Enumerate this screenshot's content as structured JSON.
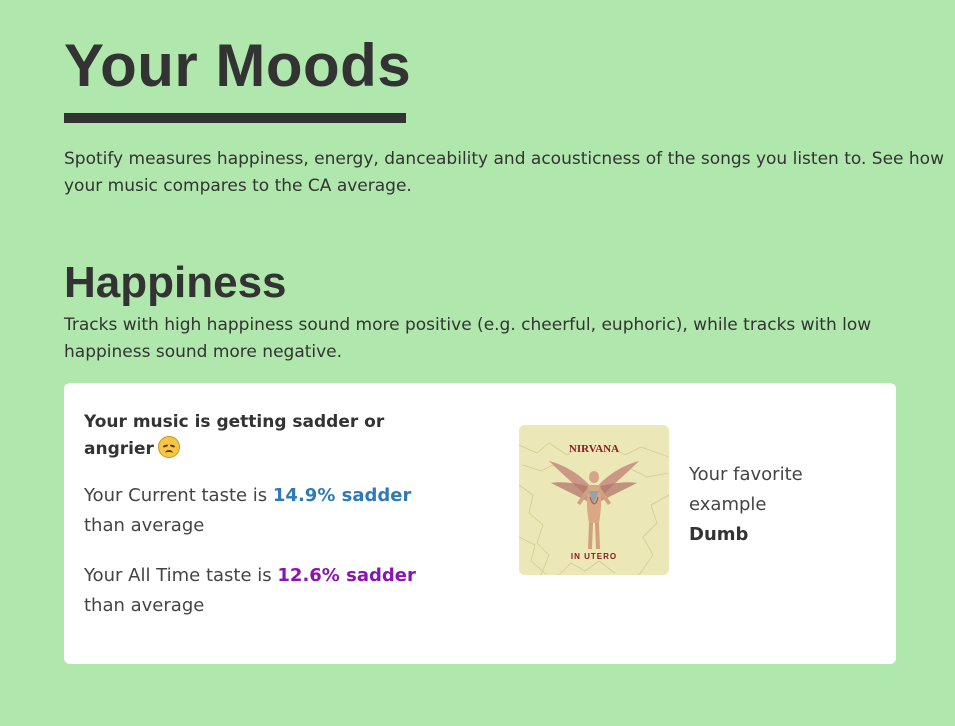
{
  "page": {
    "title": "Your Moods",
    "intro": "Spotify measures happiness, energy, danceability and acousticness of the songs you listen to. See how your music compares to the CA average."
  },
  "section": {
    "title": "Happiness",
    "description": "Tracks with high happiness sound more positive (e.g. cheerful, euphoric), while tracks with low happiness sound more negative."
  },
  "card": {
    "heading": "Your music is getting sadder or angrier",
    "heading_icon": "sad-face-emoji",
    "current": {
      "prefix": "Your Current taste is ",
      "value": "14.9% sadder",
      "suffix": " than average",
      "color": "#2f7ab6"
    },
    "all_time": {
      "prefix": "Your All Time taste is ",
      "value": "12.6% sadder",
      "suffix": " than average",
      "color": "#8a14b0"
    },
    "album": {
      "artist_text": "NIRVANA",
      "album_text": "IN UTERO"
    },
    "favorite": {
      "label": "Your favorite example",
      "track": "Dumb"
    }
  },
  "colors": {
    "background": "#b0e7ad",
    "text": "#333333",
    "card": "#ffffff"
  }
}
